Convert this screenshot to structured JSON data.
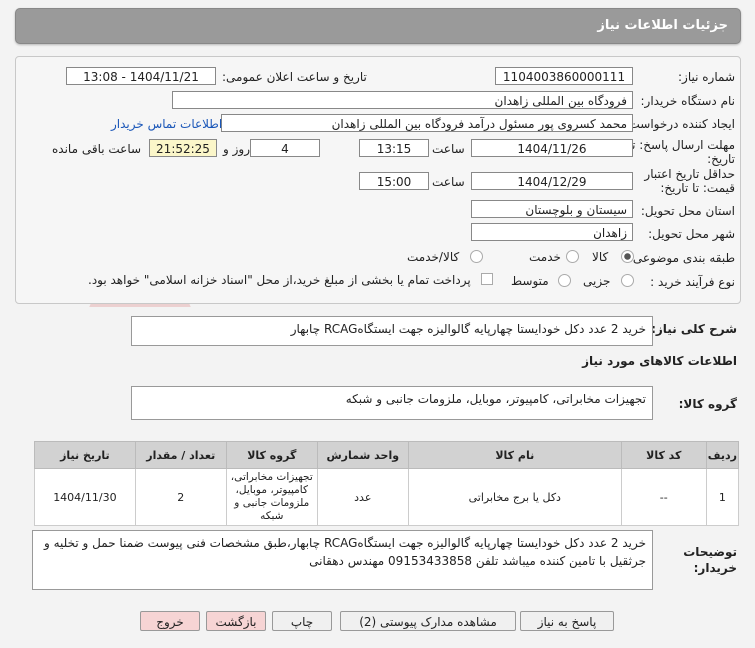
{
  "header": {
    "title": "جزئیات اطلاعات نیاز"
  },
  "form": {
    "need_number_label": "شماره نیاز:",
    "need_number": "1104003860000111",
    "announce_label": "تاریخ و ساعت اعلان عمومی:",
    "announce_value": "1404/11/21 - 13:08",
    "buyer_label": "نام دستگاه خریدار:",
    "buyer": "فرودگاه بین المللی زاهدان",
    "creator_label": "ایجاد کننده درخواست:",
    "creator": "محمد کسروی پور مسئول درآمد فرودگاه بین المللی زاهدان",
    "contact_link": "اطلاعات تماس خریدار",
    "deadline_label_1": "مهلت ارسال پاسخ: تا",
    "deadline_label_2": "تاریخ:",
    "deadline_date": "1404/11/26",
    "time_label": "ساعت",
    "deadline_time": "13:15",
    "days": "4",
    "days_label": "روز و",
    "remaining_time": "21:52:25",
    "remaining_label": "ساعت باقی مانده",
    "validity_label_1": "حداقل تاریخ اعتبار",
    "validity_label_2": "قیمت: تا تاریخ:",
    "validity_date": "1404/12/29",
    "validity_time_label": "ساعت",
    "validity_time": "15:00",
    "province_label": "استان محل تحویل:",
    "province": "سیستان و بلوچستان",
    "city_label": "شهر محل تحویل:",
    "city": "زاهدان",
    "category_label": "طبقه بندی موضوعی:",
    "category_options": [
      "کالا",
      "خدمت",
      "کالا/خدمت"
    ],
    "process_label": "نوع فرآیند خرید :",
    "process_options": [
      "جزیی",
      "متوسط"
    ],
    "payment_note": "پرداخت تمام یا بخشی از مبلغ خرید،از محل \"اسناد خزانه اسلامی\" خواهد بود."
  },
  "need": {
    "summary_label": "شرح کلی نیاز:",
    "summary": "خرید 2 عدد دکل خودایستا چهارپایه گالوالیزه جهت ایستگاهRCAG چابهار",
    "goods_title": "اطلاعات کالاهای مورد نیاز",
    "group_label": "گروه کالا:",
    "group": "تجهیزات مخابراتی، کامپیوتر، موبایل، ملزومات جانبی و شبکه"
  },
  "table": {
    "headers": [
      "ردیف",
      "کد کالا",
      "نام کالا",
      "واحد شمارش",
      "گروه کالا",
      "تعداد / مقدار",
      "تاریخ نیاز"
    ],
    "rows": [
      {
        "row": "1",
        "code": "--",
        "name": "دکل یا برج مخابراتی",
        "unit": "عدد",
        "group": "تجهیزات مخابراتی، کامپیوتر، موبایل، ملزومات جانبی و شبکه",
        "qty": "2",
        "date": "1404/11/30"
      }
    ]
  },
  "notes": {
    "label_1": "توضیحات",
    "label_2": "خریدار:",
    "text": "خرید 2 عدد دکل خودایستا چهارپایه گالوالیزه جهت ایستگاهRCAG چابهار،طبق مشخصات فنی پیوست ضمنا حمل و تخلیه و جرثقیل با تامین کننده میباشد تلفن 09153433858 مهندس دهقانی"
  },
  "buttons": {
    "reply": "پاسخ به نیاز",
    "docs": "مشاهده مدارک پیوستی (2)",
    "print": "چاپ",
    "back": "بازگشت",
    "exit": "خروج"
  },
  "watermark": {
    "text": "AriaTender.net"
  }
}
